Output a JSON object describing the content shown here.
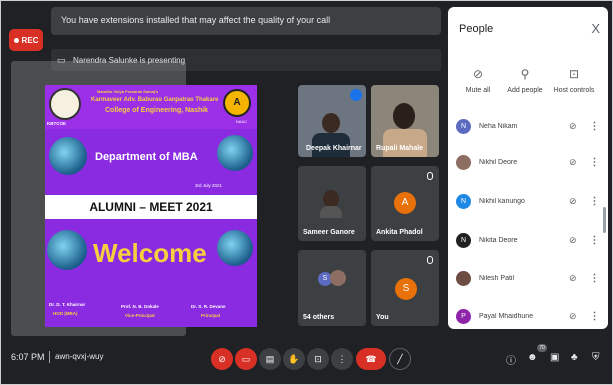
{
  "notification": {
    "text": "You have extensions installed that may affect the quality of your call"
  },
  "recording": {
    "label": "REC"
  },
  "presenting": {
    "text": "Narendra Salunke is presenting"
  },
  "slide": {
    "institute_line1": "Maratha Vidya Prasarak Samaj's",
    "institute_line2": "Karmaveer Adv. Baburao Ganpatrao Thakare",
    "institute_line3": "College of Engineering, Nashik",
    "logo_text": "KBTCOE",
    "naac_label": "NAAC",
    "department": "Department of MBA",
    "date": "3rd July 2021",
    "event": "ALUMNI – MEET 2021",
    "welcome": "Welcome",
    "people": [
      {
        "name": "Dr. D. T. Khairnar",
        "role": "HOD (MBA)"
      },
      {
        "name": "Prof. N. B. Dokale",
        "role": "Vice-Principal"
      },
      {
        "name": "Dr. S. R. Devane",
        "role": "Principal"
      }
    ]
  },
  "tiles": [
    {
      "name": "Deepak Khairnar",
      "avatar": ""
    },
    {
      "name": "Rupali Mahale",
      "avatar": ""
    },
    {
      "name": "Sameer Ganore",
      "avatar": ""
    },
    {
      "name": "Ankita Phadol",
      "avatar": "A",
      "color": "#e8710a"
    },
    {
      "name": "54 others",
      "avatar": "S"
    },
    {
      "name": "You",
      "avatar": "S",
      "color": "#e8710a"
    }
  ],
  "panel": {
    "title": "People",
    "close": "X",
    "controls": [
      {
        "label": "Mute all",
        "icon": "mic-off-icon"
      },
      {
        "label": "Add people",
        "icon": "add-person-icon"
      },
      {
        "label": "Host controls",
        "icon": "lock-icon"
      }
    ],
    "people": [
      {
        "name": "Neha Nikam",
        "initial": "N",
        "color": "#5c6bc0"
      },
      {
        "name": "Nikhil Deore",
        "initial": "",
        "color": "#8d6e63"
      },
      {
        "name": "Nikhil kanungo",
        "initial": "N",
        "color": "#1e88e5"
      },
      {
        "name": "Nikita Deore",
        "initial": "N",
        "color": "#212121"
      },
      {
        "name": "Nilesh Patil",
        "initial": "",
        "color": "#6d4c41"
      },
      {
        "name": "Payal Mhaidhune",
        "initial": "P",
        "color": "#8e24aa"
      }
    ]
  },
  "bottom": {
    "time": "6:07 PM",
    "meeting_code": "awn-qvxj-wuy",
    "participant_count": "70"
  }
}
